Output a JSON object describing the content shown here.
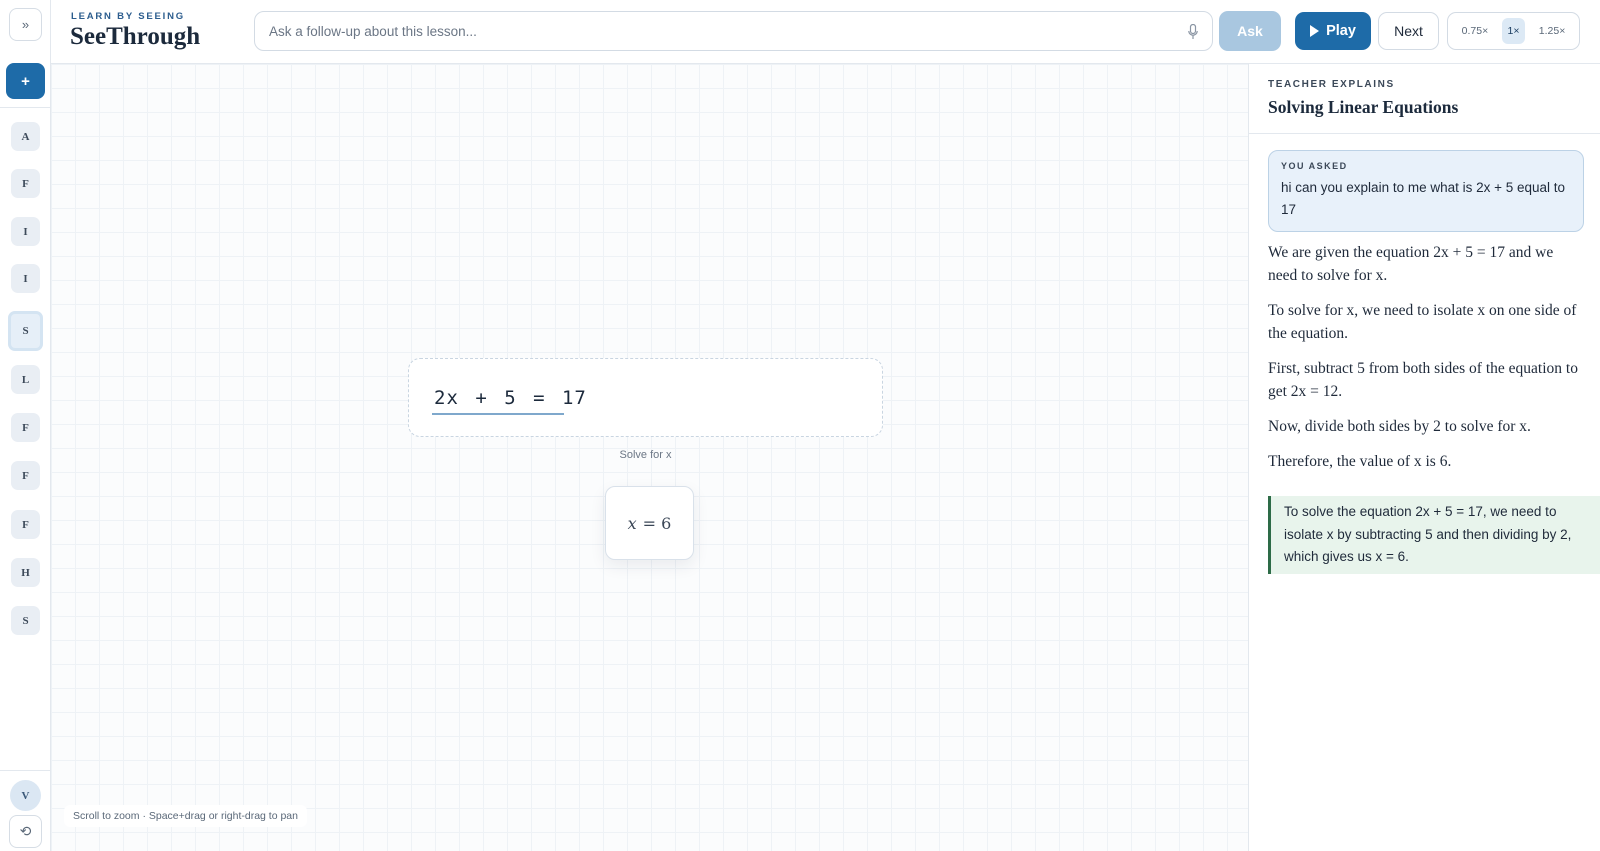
{
  "rail": {
    "expand_glyph": "»",
    "new_glyph": "+",
    "lessons": [
      "A",
      "F",
      "I",
      "I",
      "S",
      "L",
      "F",
      "F",
      "F",
      "H",
      "S"
    ],
    "active_index": 4,
    "user_initial": "V",
    "reset_glyph": "⟲"
  },
  "header": {
    "kicker": "LEARN BY SEEING",
    "brand": "SeeThrough",
    "search_placeholder": "Ask a follow-up about this lesson...",
    "ask_label": "Ask",
    "play_label": "Play",
    "next_label": "Next",
    "speeds": [
      "0.75×",
      "1×",
      "1.25×"
    ],
    "active_speed": "1×"
  },
  "canvas": {
    "equation": "2x + 5 = 17",
    "caption": "Solve for x",
    "answer_var": "x",
    "answer_rest": "= 6",
    "hint": "Scroll to zoom · Space+drag or right-drag to pan"
  },
  "panel": {
    "kicker": "TEACHER EXPLAINS",
    "title": "Solving Linear Equations",
    "asked_label": "YOU ASKED",
    "asked_text": "hi can you explain to me what is 2x + 5 equal to 17",
    "paragraphs": [
      "We are given the equation 2x + 5 = 17 and we need to solve for x.",
      "To solve for x, we need to isolate x on one side of the equation.",
      "First, subtract 5 from both sides of the equation to get 2x = 12.",
      "Now, divide both sides by 2 to solve for x.",
      "Therefore, the value of x is 6."
    ],
    "summary": "To solve the equation 2x + 5 = 17, we need to isolate x by subtracting 5 and then dividing by 2, which gives us x = 6."
  },
  "colors": {
    "accent": "#1e6ba8",
    "ask_disabled": "#a9c7e0",
    "summary_bg": "#e8f4ec",
    "summary_border": "#2d6b47",
    "asked_bg": "#e8f1fa"
  }
}
